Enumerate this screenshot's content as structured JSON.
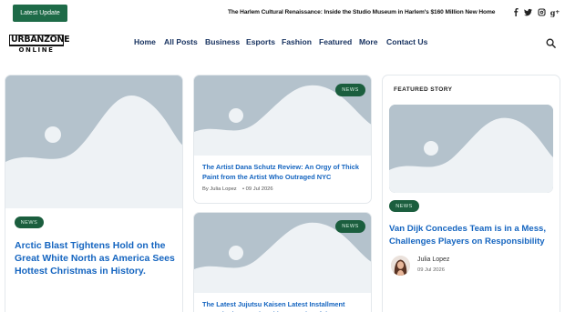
{
  "topbar": {
    "latest_label": "Latest Update",
    "ticker": "The Harlem Cultural Renaissance: Inside the Studio Museum in Harlem's $160 Million New Home",
    "social": [
      "facebook-icon",
      "twitter-icon",
      "instagram-icon",
      "google-plus-icon"
    ]
  },
  "logo": {
    "top": "URBANZONE",
    "bottom": "ONLINE"
  },
  "nav": {
    "items": [
      "Home",
      "All Posts",
      "Business",
      "Esports",
      "Fashion",
      "Featured",
      "More",
      "Contact Us"
    ]
  },
  "colors": {
    "accent": "#1e6b48",
    "nav_text": "#15305e",
    "link": "#1565c0",
    "placeholder": "#b4c2cc"
  },
  "cards": {
    "left": {
      "badge": "NEWS",
      "title": "Arctic Blast Tightens Hold on the Great White North as America Sees Hottest Christmas in History."
    },
    "middle_top": {
      "badge": "NEWS",
      "title": "The Artist Dana Schutz Review: An Orgy of Thick Paint from the Artist Who Outraged NYC",
      "author": "By Julia Lopez",
      "date": "09 Jul 2026"
    },
    "middle_bottom": {
      "badge": "NEWS",
      "title": "The Latest Jujutsu Kaisen Latest Installment Reveals the Heartbreaking Results of the"
    }
  },
  "featured": {
    "label": "FEATURED STORY",
    "badge": "NEWS",
    "title": "Van Dijk Concedes Team is in a Mess, Challenges Players on Responsibility",
    "author": "Julia Lopez",
    "date": "09 Jul 2026"
  }
}
